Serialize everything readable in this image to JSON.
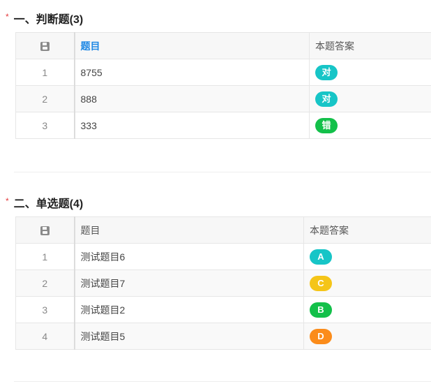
{
  "section1": {
    "required_mark": "*",
    "title": "一、判断题(3)",
    "columns": {
      "index_icon": "save-icon",
      "question": "题目",
      "answer": "本题答案"
    },
    "rows": [
      {
        "index": "1",
        "question": "8755",
        "answer": "对",
        "answer_color": "#17c5c7"
      },
      {
        "index": "2",
        "question": "888",
        "answer": "对",
        "answer_color": "#17c5c7"
      },
      {
        "index": "3",
        "question": "333",
        "answer": "错",
        "answer_color": "#13c04a"
      }
    ]
  },
  "section2": {
    "required_mark": "*",
    "title": "二、单选题(4)",
    "columns": {
      "index_icon": "save-icon",
      "question": "题目",
      "answer": "本题答案"
    },
    "rows": [
      {
        "index": "1",
        "question": "测试题目6",
        "answer": "A",
        "answer_color": "#17c5c7"
      },
      {
        "index": "2",
        "question": "测试题目7",
        "answer": "C",
        "answer_color": "#f5c518"
      },
      {
        "index": "3",
        "question": "测试题目2",
        "answer": "B",
        "answer_color": "#13c04a"
      },
      {
        "index": "4",
        "question": "测试题目5",
        "answer": "D",
        "answer_color": "#fb8c1b"
      }
    ]
  }
}
